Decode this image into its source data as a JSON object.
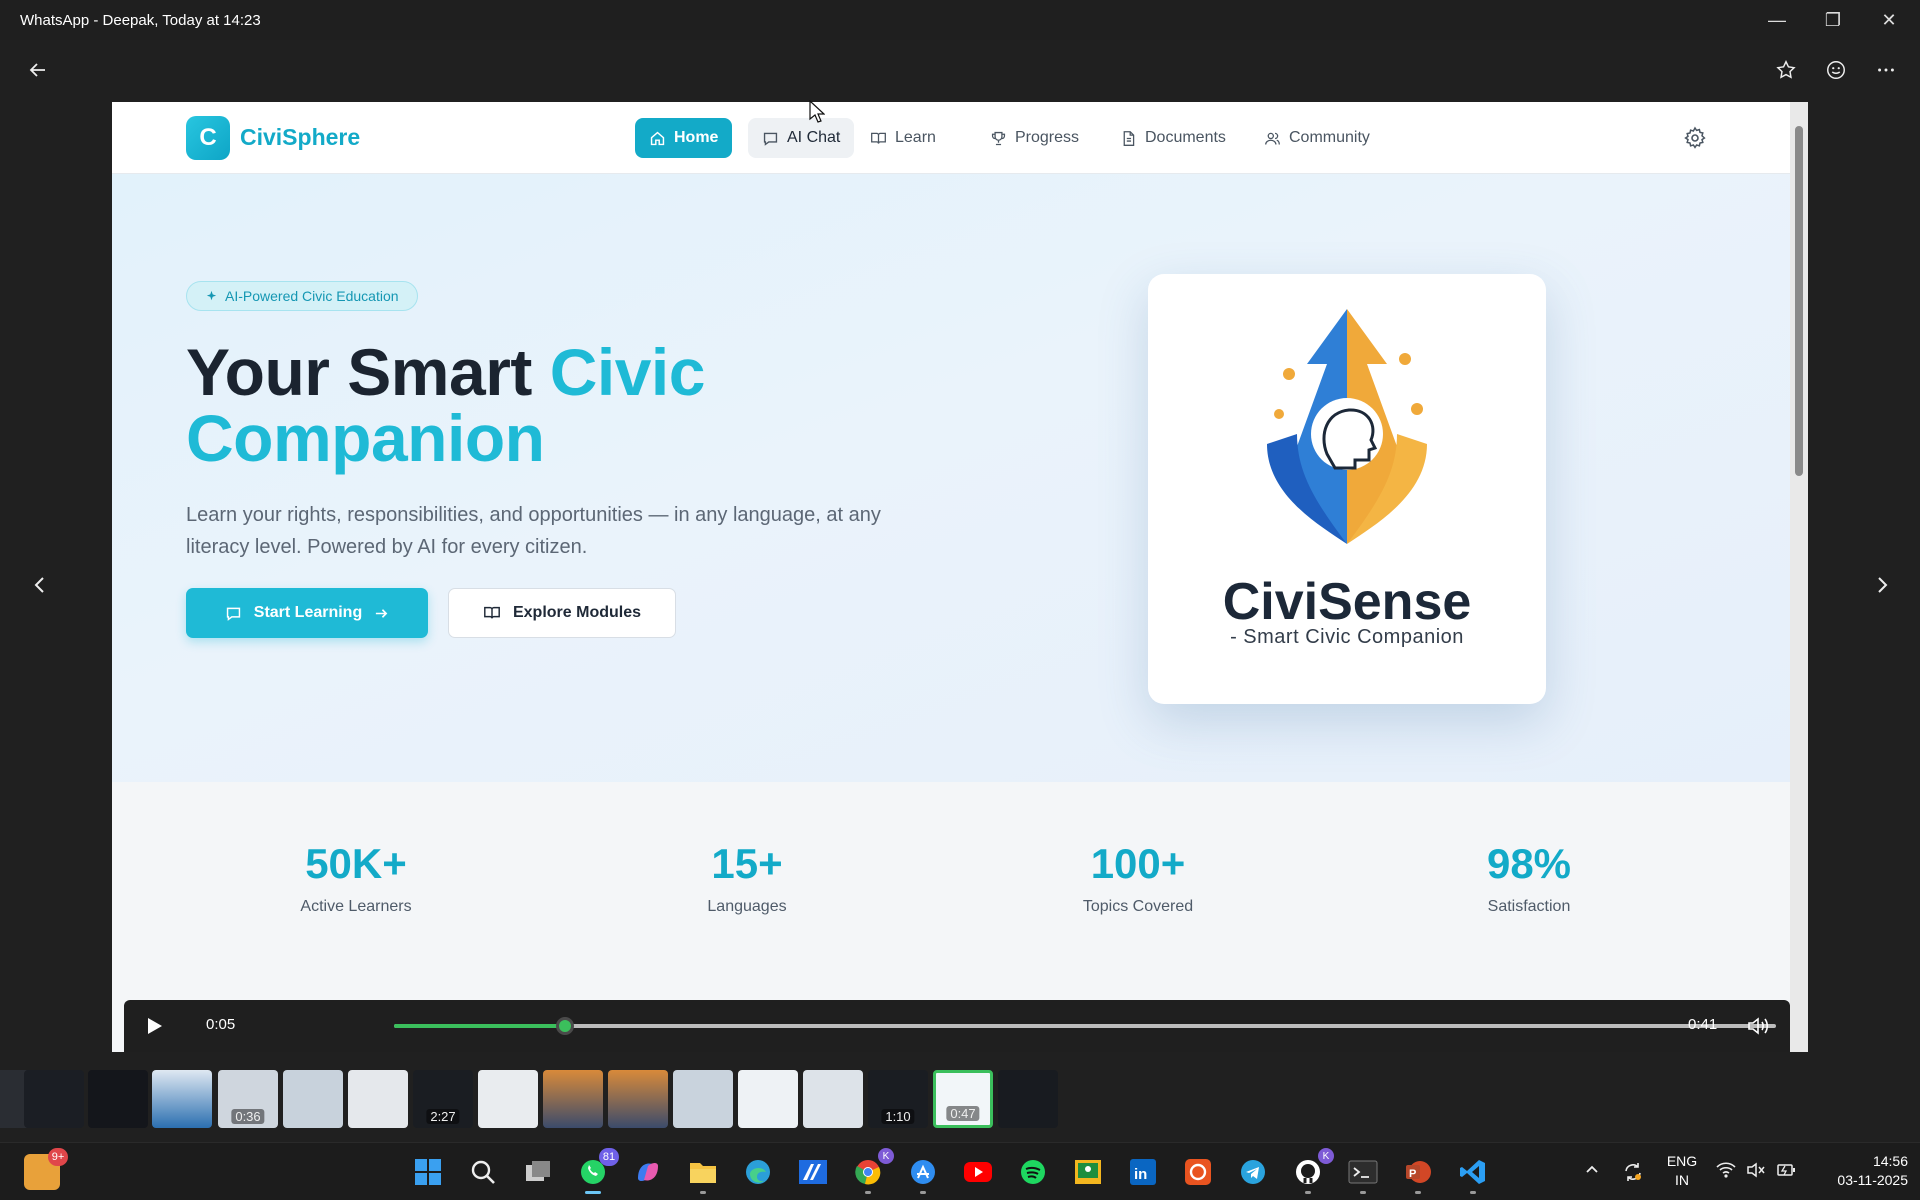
{
  "window": {
    "title": "WhatsApp - Deepak, Today at 14:23"
  },
  "site": {
    "logo_letter": "C",
    "brand": "CiviSphere",
    "nav": [
      {
        "label": "Home"
      },
      {
        "label": "AI Chat"
      },
      {
        "label": "Learn"
      },
      {
        "label": "Progress"
      },
      {
        "label": "Documents"
      },
      {
        "label": "Community"
      }
    ],
    "hero": {
      "badge": "AI-Powered Civic Education",
      "title_plain": "Your Smart ",
      "title_accent_1": "Civic",
      "title_accent_2": "Companion",
      "subtitle": "Learn your rights, responsibilities, and opportunities — in any language, at any literacy level. Powered by AI for every citizen.",
      "primary_button": "Start Learning",
      "secondary_button": "Explore Modules",
      "card_name": "CiviSense",
      "card_tagline": "- Smart Civic Companion"
    },
    "stats": [
      {
        "value": "50K+",
        "label": "Active Learners"
      },
      {
        "value": "15+",
        "label": "Languages"
      },
      {
        "value": "100+",
        "label": "Topics Covered"
      },
      {
        "value": "98%",
        "label": "Satisfaction"
      }
    ]
  },
  "player": {
    "current_time": "0:05",
    "total_time": "0:41",
    "progress_fraction": 0.124
  },
  "filmstrip": {
    "durations": [
      "0:36",
      "2:27",
      "1:10",
      "0:47"
    ]
  },
  "taskbar": {
    "notification_badge": "9+",
    "whatsapp_badge": "81",
    "copilot_badge": "K",
    "github_badge": "K",
    "lang_top": "ENG",
    "lang_bottom": "IN",
    "clock_time": "14:56",
    "clock_date": "03-11-2025"
  },
  "colors": {
    "accent": "#13aac8",
    "accent_light": "#1fbad6",
    "progress": "#3bbf5c"
  }
}
